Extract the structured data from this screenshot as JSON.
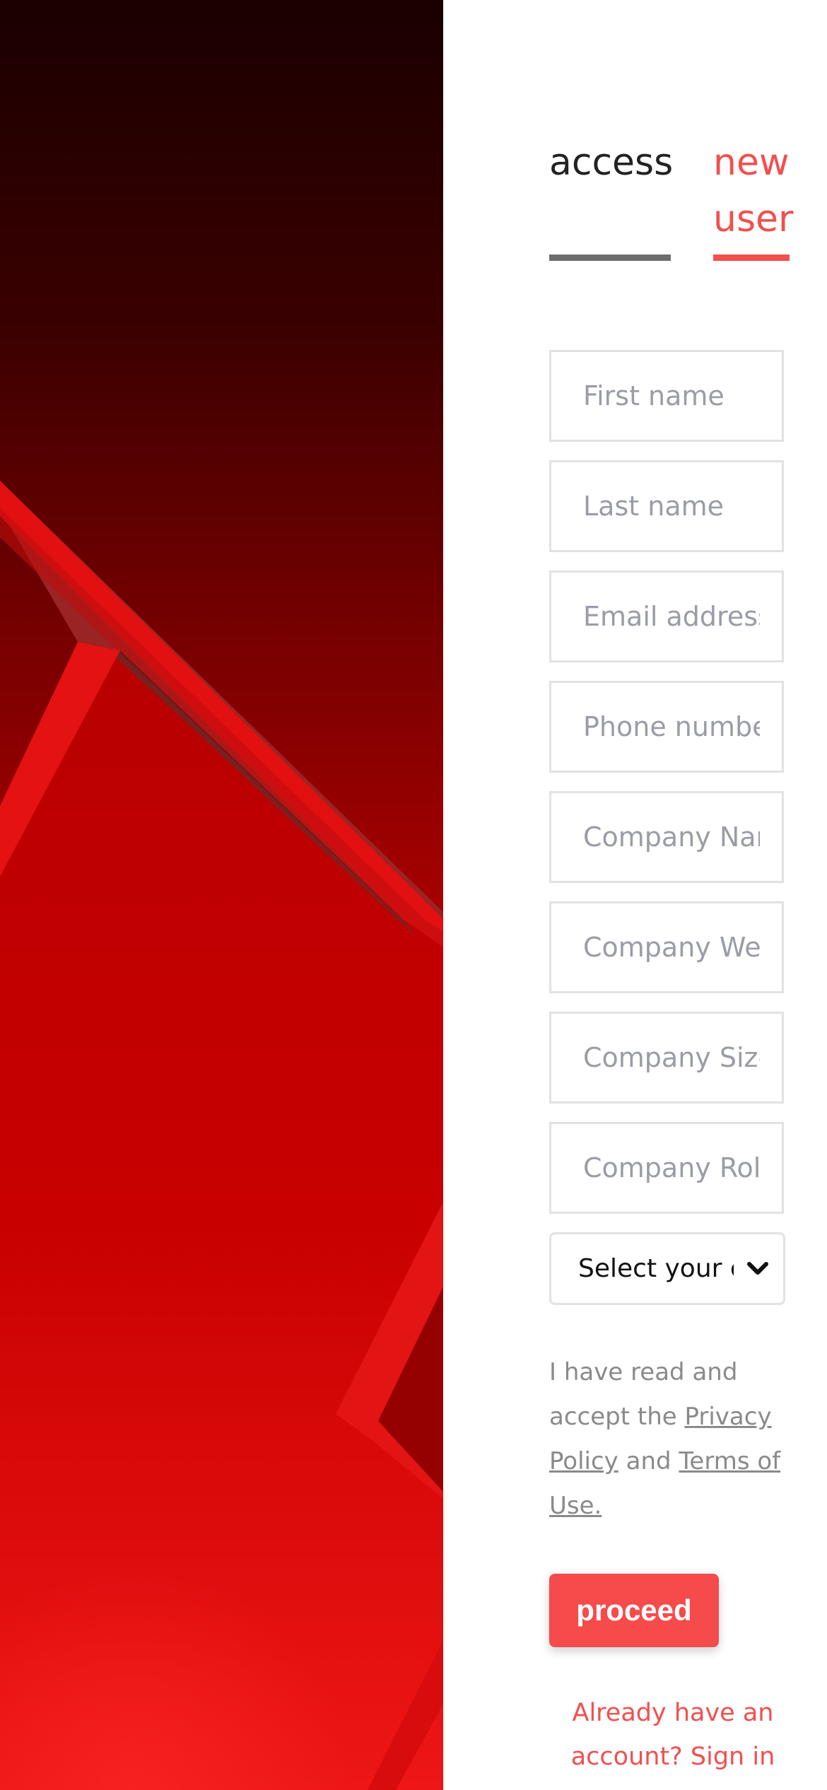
{
  "tabs": {
    "access_label": "access",
    "new_user_label": "new user",
    "active": "new user"
  },
  "form": {
    "fields": [
      {
        "placeholder": "First name",
        "value": ""
      },
      {
        "placeholder": "Last name",
        "value": ""
      },
      {
        "placeholder": "Email address",
        "value": ""
      },
      {
        "placeholder": "Phone number",
        "value": ""
      },
      {
        "placeholder": "Company Name",
        "value": ""
      },
      {
        "placeholder": "Company Website",
        "value": ""
      },
      {
        "placeholder": "Company Size",
        "value": ""
      },
      {
        "placeholder": "Company Role",
        "value": ""
      }
    ],
    "country_select": "Select your country"
  },
  "consent": {
    "prefix": "I have read and accept the ",
    "privacy_link": "Privacy Policy",
    "middle": " and ",
    "terms_link": "Terms of Use."
  },
  "proceed_label": "proceed",
  "signin_text": "Already have an account? Sign in",
  "colors": {
    "accent": "#f24f4f",
    "button": "#f64b4b",
    "tab_inactive_underline": "#6d6d6d",
    "input_border": "#e2e2e4",
    "placeholder": "#9a9ca6",
    "text_muted": "#8a8a8a"
  },
  "icons": {
    "select_chevron": "chevron-down-icon"
  }
}
